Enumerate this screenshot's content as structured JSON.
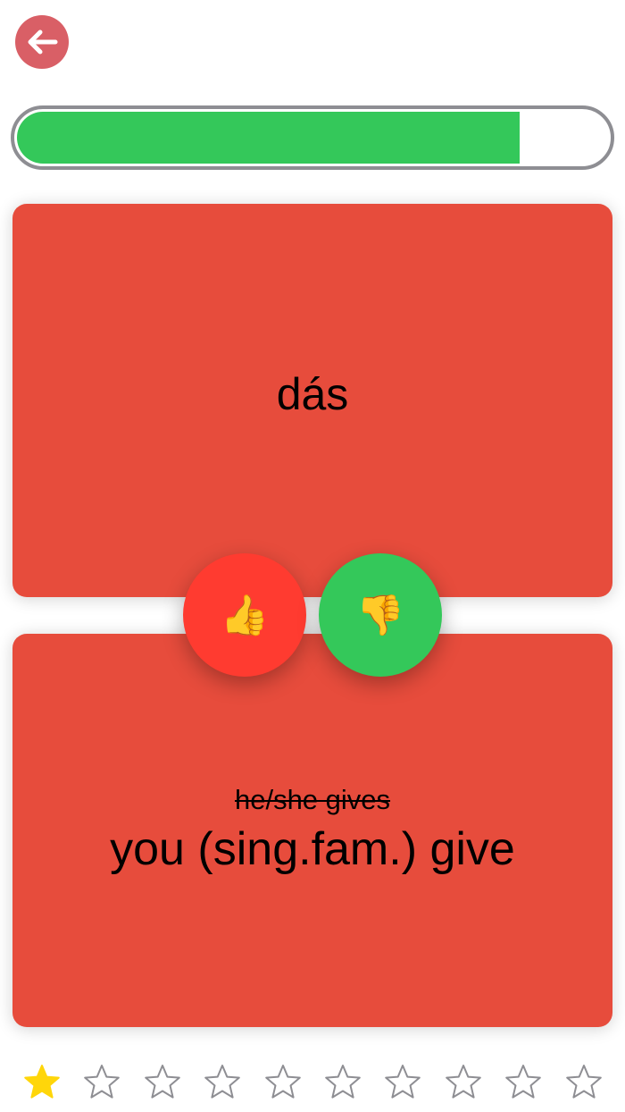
{
  "header": {
    "back_icon": "arrow-left-icon"
  },
  "progress": {
    "fraction": 0.85,
    "fill_color": "#34c85a",
    "track_color": "#8e8e93"
  },
  "card_front": {
    "word": "dás",
    "background": "#e74c3c"
  },
  "card_back": {
    "wrong_answer": "he/she gives",
    "correct_answer": "you (sing.fam.) give",
    "background": "#e74c3c"
  },
  "vote_buttons": {
    "thumbs_up": {
      "icon": "thumbs-up-icon",
      "glyph": "👍",
      "color": "#ff3b30"
    },
    "thumbs_down": {
      "icon": "thumbs-down-icon",
      "glyph": "👎",
      "color": "#34c85a"
    }
  },
  "rating": {
    "total": 10,
    "filled": 1,
    "filled_color": "#ffd60a",
    "empty_color": "#8e8e93"
  }
}
